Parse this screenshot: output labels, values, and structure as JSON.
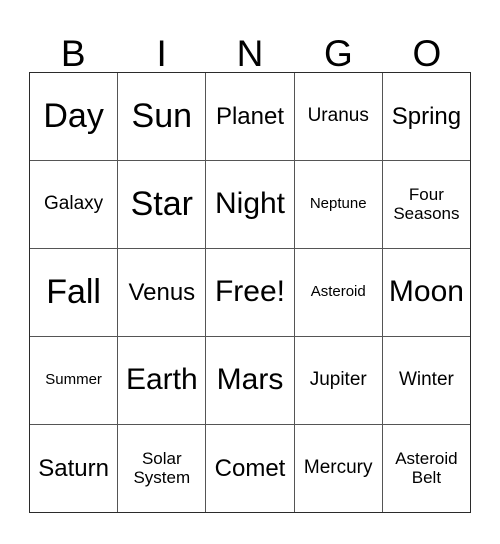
{
  "card": {
    "header_letters": [
      "B",
      "I",
      "N",
      "G",
      "O"
    ],
    "free_space_label": "Free!",
    "colors": {
      "background": "#ffffff",
      "text": "#000000",
      "outer_border": "#2b2b2b",
      "inner_border": "#555555"
    },
    "rows": [
      [
        {
          "text": "Day",
          "size": "s-xl"
        },
        {
          "text": "Sun",
          "size": "s-xl"
        },
        {
          "text": "Planet",
          "size": "s-md"
        },
        {
          "text": "Uranus",
          "size": "s-sm"
        },
        {
          "text": "Spring",
          "size": "s-md"
        }
      ],
      [
        {
          "text": "Galaxy",
          "size": "s-sm"
        },
        {
          "text": "Star",
          "size": "s-xl"
        },
        {
          "text": "Night",
          "size": "s-lg"
        },
        {
          "text": "Neptune",
          "size": "s-xxs"
        },
        {
          "text": "Four\nSeasons",
          "size": "s-xs"
        }
      ],
      [
        {
          "text": "Fall",
          "size": "s-xl"
        },
        {
          "text": "Venus",
          "size": "s-md"
        },
        {
          "text": "Free!",
          "size": "s-lg"
        },
        {
          "text": "Asteroid",
          "size": "s-xxs"
        },
        {
          "text": "Moon",
          "size": "s-lg"
        }
      ],
      [
        {
          "text": "Summer",
          "size": "s-xxs"
        },
        {
          "text": "Earth",
          "size": "s-lg"
        },
        {
          "text": "Mars",
          "size": "s-lg"
        },
        {
          "text": "Jupiter",
          "size": "s-sm"
        },
        {
          "text": "Winter",
          "size": "s-sm"
        }
      ],
      [
        {
          "text": "Saturn",
          "size": "s-md"
        },
        {
          "text": "Solar\nSystem",
          "size": "s-xs"
        },
        {
          "text": "Comet",
          "size": "s-md"
        },
        {
          "text": "Mercury",
          "size": "s-sm"
        },
        {
          "text": "Asteroid\nBelt",
          "size": "s-xs"
        }
      ]
    ]
  }
}
